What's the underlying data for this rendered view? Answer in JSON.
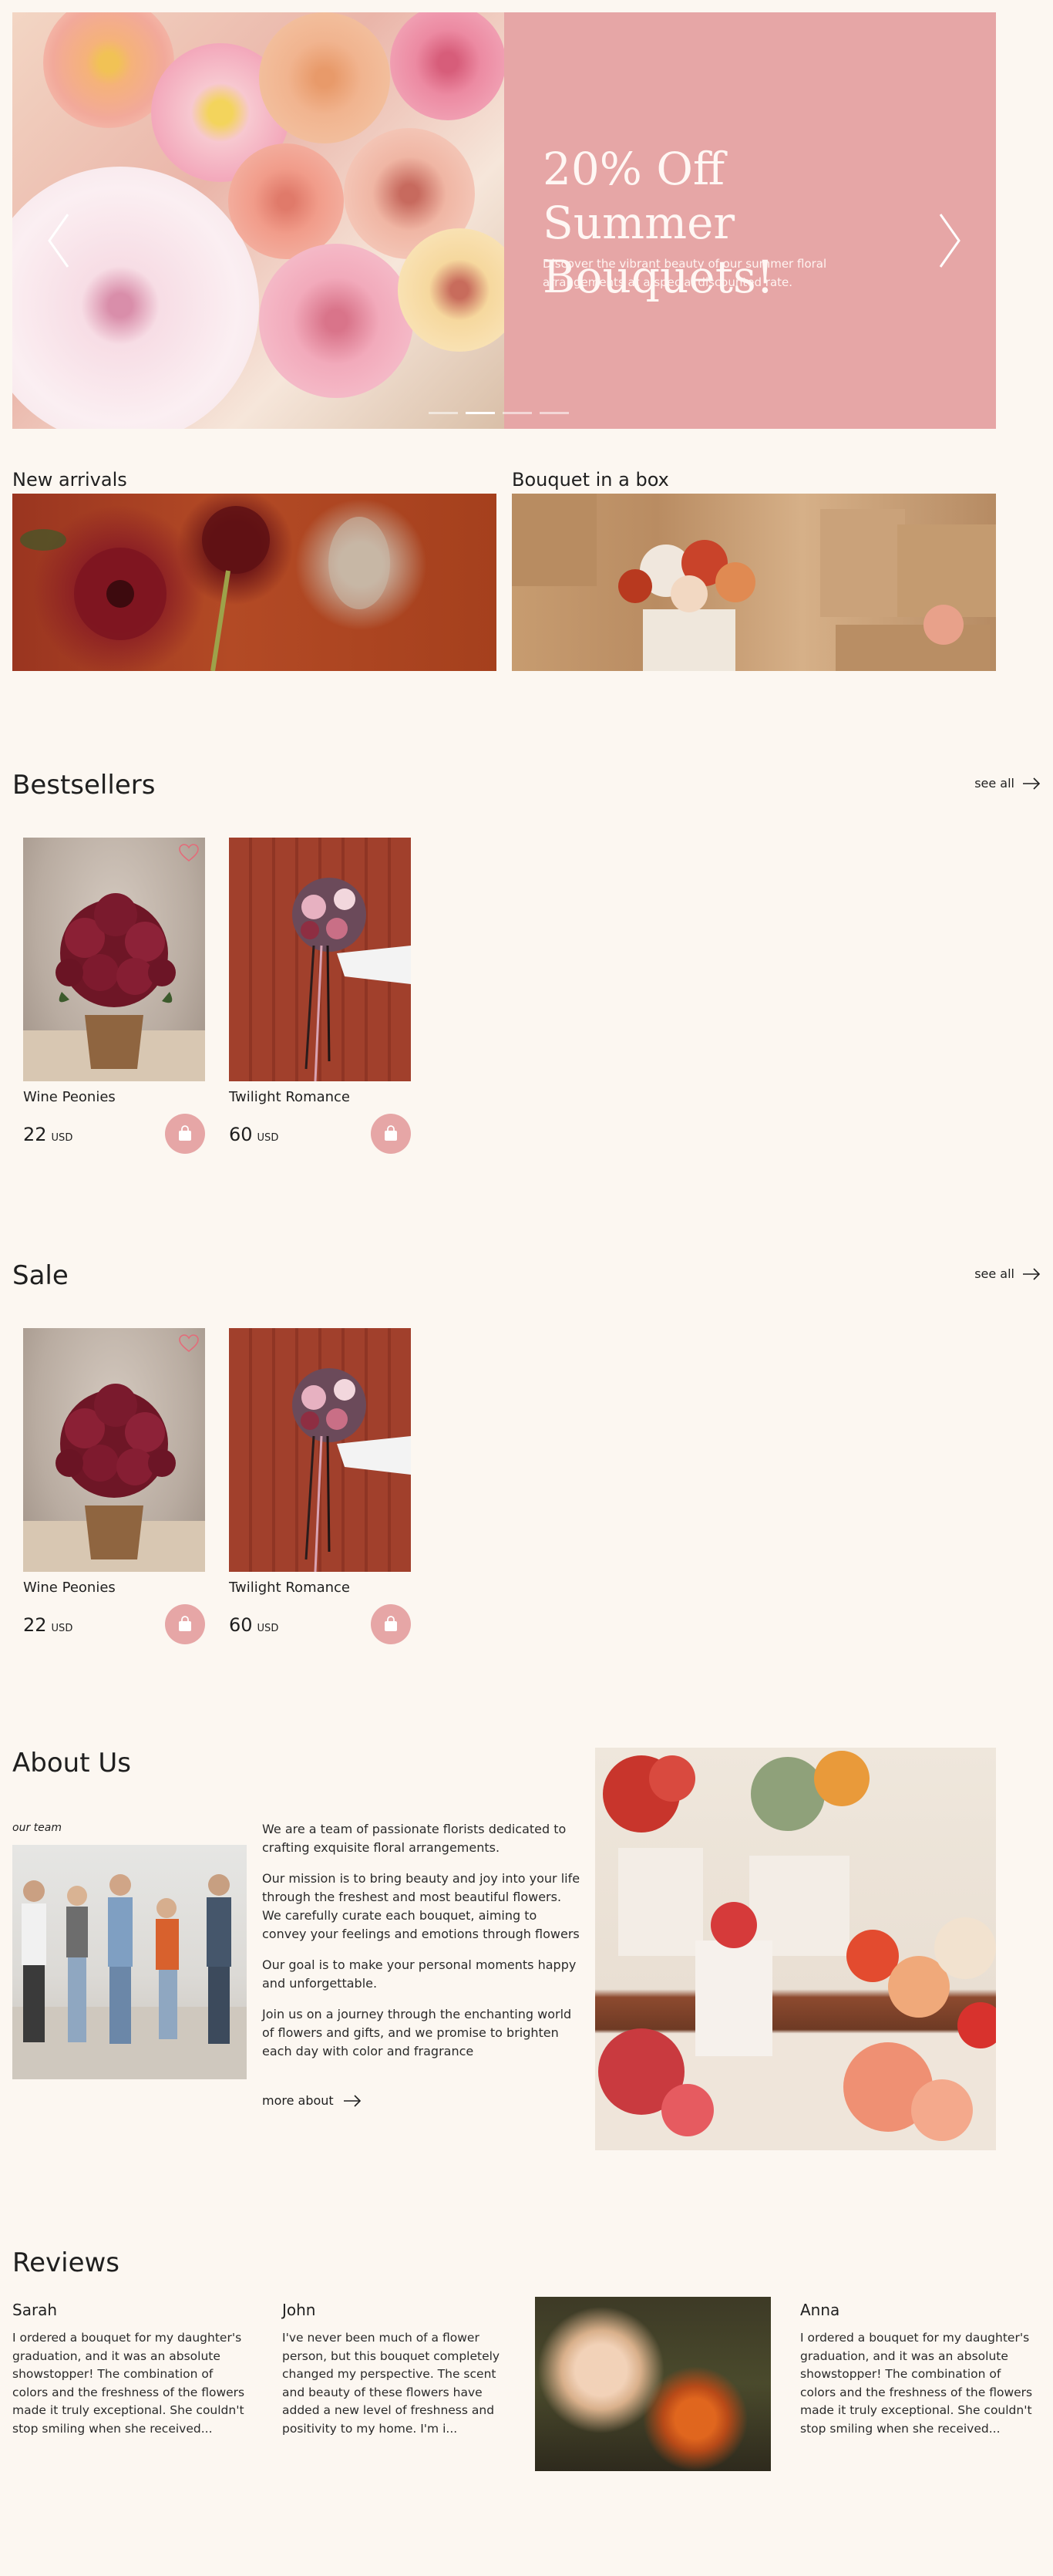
{
  "hero": {
    "title": "20% Off Summer Bouquets!",
    "subtitle": "Discover the vibrant beauty of our summer floral arrangements at a special discounted rate.",
    "prev_icon": "chevron-left-icon",
    "next_icon": "chevron-right-icon",
    "slides_count": 4,
    "active_slide": 1
  },
  "categories": [
    {
      "title": "New arrivals"
    },
    {
      "title": "Bouquet in a box"
    }
  ],
  "bestsellers": {
    "title": "Bestsellers",
    "see_all": "see all",
    "products": [
      {
        "name": "Wine Peonies",
        "price": "22",
        "currency": "USD"
      },
      {
        "name": "Twilight Romance",
        "price": "60",
        "currency": "USD"
      }
    ]
  },
  "sale": {
    "title": "Sale",
    "see_all": "see all",
    "products": [
      {
        "name": "Wine Peonies",
        "price": "22",
        "currency": "USD"
      },
      {
        "name": "Twilight Romance",
        "price": "60",
        "currency": "USD"
      }
    ]
  },
  "about": {
    "title": "About Us",
    "caption": "our team",
    "paragraphs": [
      "We are a team of passionate florists dedicated to crafting exquisite floral arrangements.",
      "Our mission is to bring beauty and joy into your life through the freshest and most beautiful flowers. We carefully curate each bouquet, aiming to convey your feelings and emotions through flowers",
      "Our goal is to make your personal moments happy and unforgettable.",
      "Join us on a journey through the enchanting world of flowers and gifts, and we promise to brighten each day with color and fragrance"
    ],
    "more": "more about"
  },
  "reviews": {
    "title": "Reviews",
    "items": [
      {
        "name": "Sarah",
        "text": "I ordered a bouquet for my daughter's graduation, and it was an absolute showstopper! The combination of colors and the freshness of the flowers made it truly exceptional. She couldn't stop smiling when she received..."
      },
      {
        "name": "John",
        "text": "I've never been much of a flower person, but this bouquet completely changed my perspective. The scent and beauty of these flowers have added a new level of freshness and positivity to my home. I'm i..."
      },
      {
        "name": "Anna",
        "text": "I ordered a bouquet for my daughter's graduation, and it was an absolute showstopper! The combination of colors and the freshness of the flowers made it truly exceptional. She couldn't stop smiling when she received..."
      }
    ]
  },
  "colors": {
    "background": "#fcf7f1",
    "accent_pink": "#e6a6a6",
    "text": "#1f1f1f"
  },
  "icons": {
    "favorite": "heart-icon",
    "cart": "shopping-bag-icon",
    "see_all": "arrow-right-icon"
  }
}
